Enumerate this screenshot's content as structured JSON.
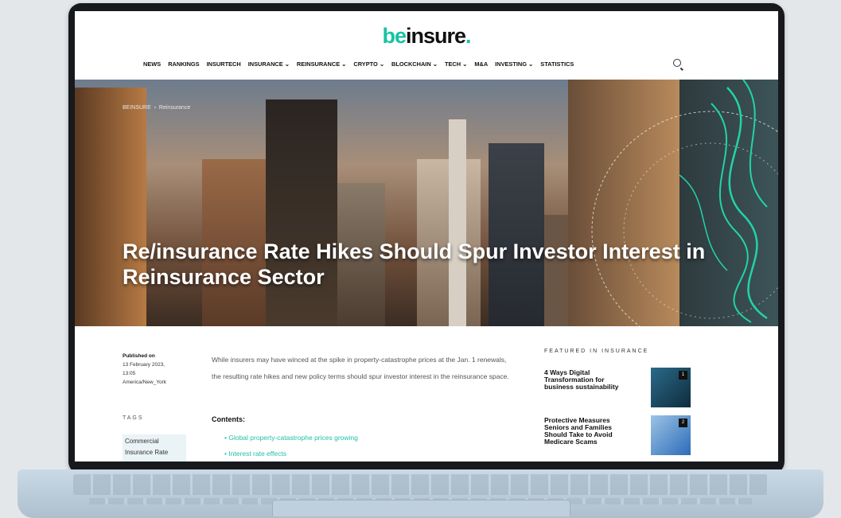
{
  "site": {
    "logo_part1": "be",
    "logo_part2": "insure",
    "logo_dot": "."
  },
  "nav": [
    "NEWS",
    "RANKINGS",
    "INSURTECH",
    "INSURANCE ⌄",
    "REINSURANCE ⌄",
    "CRYPTO ⌄",
    "BLOCKCHAIN ⌄",
    "TECH ⌄",
    "M&A",
    "INVESTING ⌄",
    "STATISTICS"
  ],
  "breadcrumb": {
    "home": "BEINSURE",
    "sep": "›",
    "current": "Reinsurance"
  },
  "article": {
    "title": "Re/insurance Rate Hikes Should Spur Investor Interest in Reinsurance Sector",
    "published_label": "Published on",
    "published_date": "13 February 2023,",
    "published_time": "13:05",
    "timezone": "America/New_York",
    "intro": "While insurers may have winced at the spike in property-catastrophe prices at the Jan. 1 renewals, the resulting rate hikes and new policy terms should spur investor interest in the reinsurance space.",
    "contents_label": "Contents:",
    "contents": [
      "Global property-catastrophe prices growing",
      "Interest rate effects"
    ]
  },
  "tags": {
    "heading": "TAGS",
    "items": [
      "Commercial Insurance Rate"
    ]
  },
  "featured": {
    "heading": "FEATURED IN INSURANCE",
    "items": [
      {
        "title": "4 Ways Digital Transformation for business sustainability",
        "rank": "1"
      },
      {
        "title": "Protective Measures Seniors and Families Should Take to Avoid Medicare Scams",
        "rank": "2"
      }
    ]
  },
  "colors": {
    "accent": "#17c3a4",
    "laptop_frame": "#17191c"
  }
}
